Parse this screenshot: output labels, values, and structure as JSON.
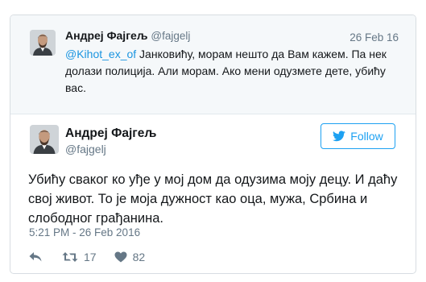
{
  "quoted_tweet": {
    "author_name": "Андреј Фајгељ",
    "author_handle": "@fajgelj",
    "date": "26 Feb 16",
    "mention": "@Kihot_ex_of",
    "text": " Јанковићу, морам нешто да Вам кажем. Па нек долази полиција. Али морам. Ако мени одузмете дете, убићу вас."
  },
  "tweet": {
    "author_name": "Андреј Фајгељ",
    "author_handle": "@fajgelj",
    "follow_label": "Follow",
    "text": "Убићу сваког ко уђе у мој дом да одузима моју децу. И даћу свој живот. То је моја дужност као оца, мужа, Србина и слободног грађанина.",
    "timestamp": "5:21 PM - 26 Feb 2016",
    "retweet_count": "17",
    "like_count": "82"
  },
  "icons": {
    "reply": "reply-icon",
    "retweet": "retweet-icon",
    "like": "heart-icon",
    "follow": "twitter-bird-icon"
  },
  "colors": {
    "accent": "#1da1f2",
    "mention": "#1b95e0",
    "muted_text": "#657786",
    "quoted_background": "#f5f8fa"
  }
}
